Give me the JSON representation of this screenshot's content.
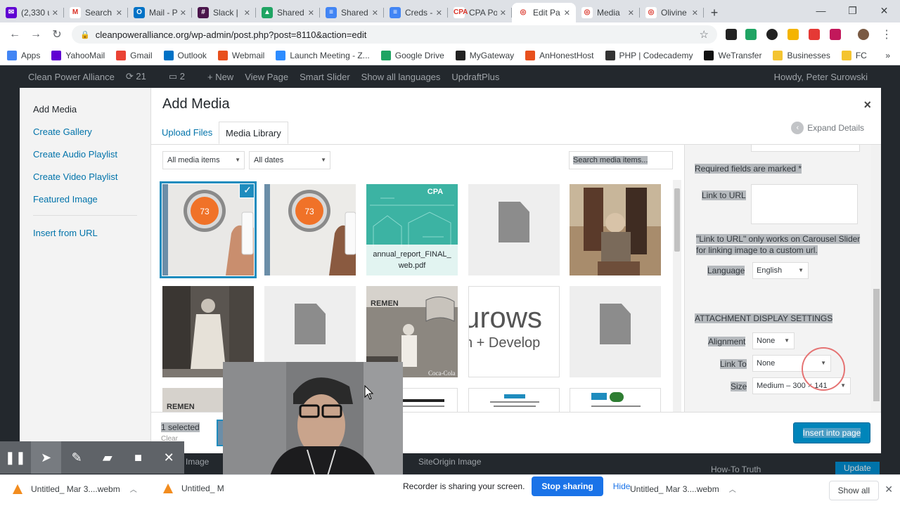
{
  "browser": {
    "tabs": [
      {
        "title": "(2,330 u",
        "fav": "#6001d2",
        "glyph": "✉"
      },
      {
        "title": "Search",
        "fav": "#fff",
        "glyph": "M"
      },
      {
        "title": "Mail - P",
        "fav": "#0072c6",
        "glyph": "O"
      },
      {
        "title": "Slack | ",
        "fav": "#4a154b",
        "glyph": "#"
      },
      {
        "title": "Shared",
        "fav": "#1fa463",
        "glyph": "▲"
      },
      {
        "title": "Shared",
        "fav": "#4285f4",
        "glyph": "≡"
      },
      {
        "title": "Creds -",
        "fav": "#4285f4",
        "glyph": "≡"
      },
      {
        "title": "CPA Po",
        "fav": "#fff",
        "glyph": "CPA"
      },
      {
        "title": "Edit Pa",
        "fav": "#fff",
        "glyph": "◎"
      },
      {
        "title": "Media",
        "fav": "#fff",
        "glyph": "◎"
      },
      {
        "title": "Olivine",
        "fav": "#fff",
        "glyph": "◎"
      }
    ],
    "active_tab": 8,
    "url": "cleanpoweralliance.org/wp-admin/post.php?post=8110&action=edit",
    "bookmarks": [
      "Apps",
      "YahooMail",
      "Gmail",
      "Outlook",
      "Webmail",
      "Launch Meeting - Z...",
      "Google Drive",
      "MyGateway",
      "AnHonestHost",
      "PHP | Codecademy",
      "WeTransfer",
      "Businesses",
      "FC"
    ],
    "bookmark_colors": [
      "#4285f4",
      "#6001d2",
      "#ea4335",
      "#0072c6",
      "#e8501d",
      "#2d8cff",
      "#1fa463",
      "#222",
      "#e8501d",
      "#333",
      "#111",
      "#f4c430",
      "#f4c430"
    ]
  },
  "wp_admin_bar": {
    "site": "Clean Power Alliance",
    "updates": "21",
    "comments": "2",
    "new": "+ New",
    "view": "View Page",
    "slider": "Smart Slider",
    "langs": "Show all languages",
    "updraft": "UpdraftPlus",
    "howdy": "Howdy, Peter Surowski"
  },
  "media_modal": {
    "title": "Add Media",
    "close": "×",
    "menu": [
      "Add Media",
      "Create Gallery",
      "Create Audio Playlist",
      "Create Video Playlist",
      "Featured Image"
    ],
    "menu_extra": "Insert from URL",
    "tabs": [
      "Upload Files",
      "Media Library"
    ],
    "expand_details": "Expand Details",
    "filter_type": "All media items",
    "filter_date": "All dates",
    "search_placeholder": "Search media items...",
    "attachments": [
      {
        "kind": "thermostat",
        "selected": true
      },
      {
        "kind": "thermostat",
        "selected": false
      },
      {
        "kind": "pdf-cover",
        "name": "annual_report_FINAL_web.pdf"
      },
      {
        "kind": "file"
      },
      {
        "kind": "photo-family"
      },
      {
        "kind": "photo-woman"
      },
      {
        "kind": "file"
      },
      {
        "kind": "photo-store"
      },
      {
        "kind": "logo-text"
      },
      {
        "kind": "file"
      }
    ],
    "pdf_label_line1": "annual_report_FINAL_",
    "pdf_label_line2": "web.pdf",
    "cpa_badge": "CPA",
    "logo_text_top": "urows",
    "logo_text_bottom": "n + Develop",
    "store_sign": "REMEN",
    "store_sign2": "Coca-Cola",
    "thermo_reading": "73",
    "selection_count": "1 selected",
    "selection_clear": "Clear",
    "insert_button": "Insert into page"
  },
  "attachment_details": {
    "required_note": "Required fields are marked *",
    "link_to_url_label": "Link to URL",
    "link_note": "\"Link to URL\" only works on Carousel Slider for linking image to a custom url.",
    "language_label": "Language",
    "language_value": "English",
    "display_settings_heading": "ATTACHMENT DISPLAY SETTINGS",
    "alignment_label": "Alignment",
    "alignment_value": "None",
    "link_to_label": "Link To",
    "link_to_value": "None",
    "size_label": "Size",
    "size_value": "Medium – 300 × 141"
  },
  "below_modal": {
    "left": "Image",
    "right": "SiteOrigin Image",
    "howto": "How-To Truth",
    "update": "Update"
  },
  "recorder": {
    "share_text": "Recorder is sharing your screen.",
    "stop": "Stop sharing",
    "hide": "Hide"
  },
  "downloads": {
    "items": [
      "Untitled_ Mar 3....webm",
      "Untitled_ M",
      "Untitled_ Mar 3....webm"
    ],
    "show_all": "Show all"
  }
}
